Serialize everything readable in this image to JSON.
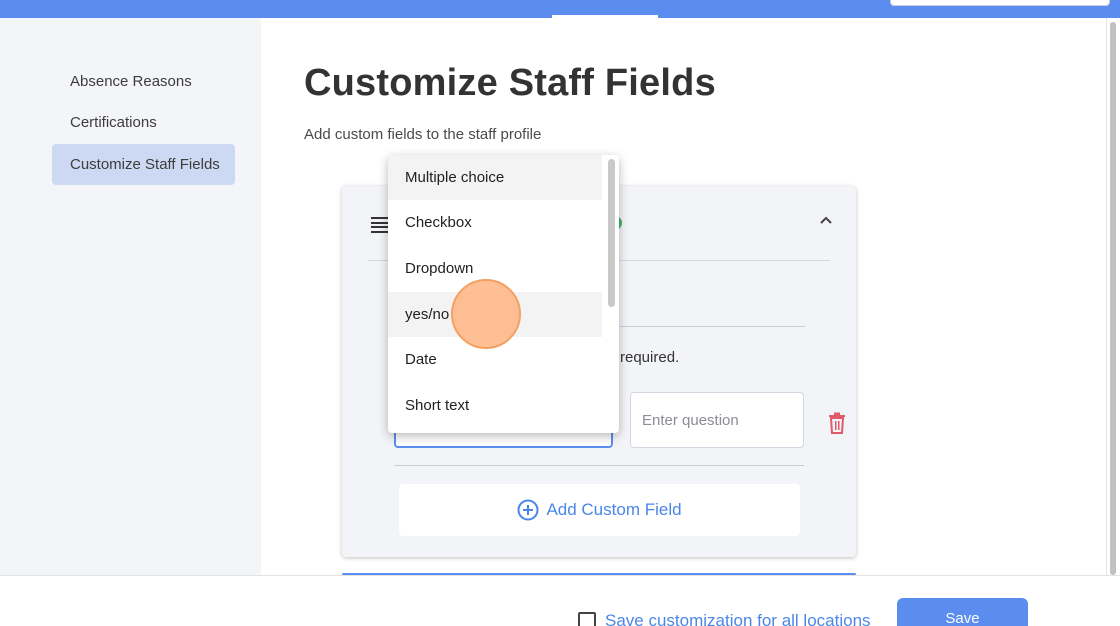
{
  "sidebar": {
    "items": [
      {
        "label": "Absence Reasons"
      },
      {
        "label": "Certifications"
      },
      {
        "label": "Customize Staff Fields",
        "active": true
      }
    ]
  },
  "main": {
    "title": "Customize Staff Fields",
    "subtitle": "Add custom fields to the staff profile",
    "card": {
      "required_text": "required.",
      "question_placeholder": "Enter question",
      "add_field_label": "Add Custom Field"
    }
  },
  "dropdown": {
    "options": [
      {
        "label": "Multiple choice",
        "highlighted": true
      },
      {
        "label": "Checkbox"
      },
      {
        "label": "Dropdown"
      },
      {
        "label": "yes/no",
        "highlighted": true
      },
      {
        "label": "Date"
      },
      {
        "label": "Short text"
      }
    ]
  },
  "footer": {
    "save_all_label": "Save customization for all locations",
    "save_all_checked": false,
    "save_label": "Save"
  },
  "icons": {
    "drag": "drag-handle-icon",
    "collapse": "chevron-up-icon",
    "delete": "trash-icon",
    "add": "plus-circle-icon"
  },
  "colors": {
    "accent": "#5b8def",
    "link": "#4a86e8",
    "sidebar_active": "#cdd9f3",
    "delete": "#e05a6a",
    "status": "#45b36b"
  }
}
